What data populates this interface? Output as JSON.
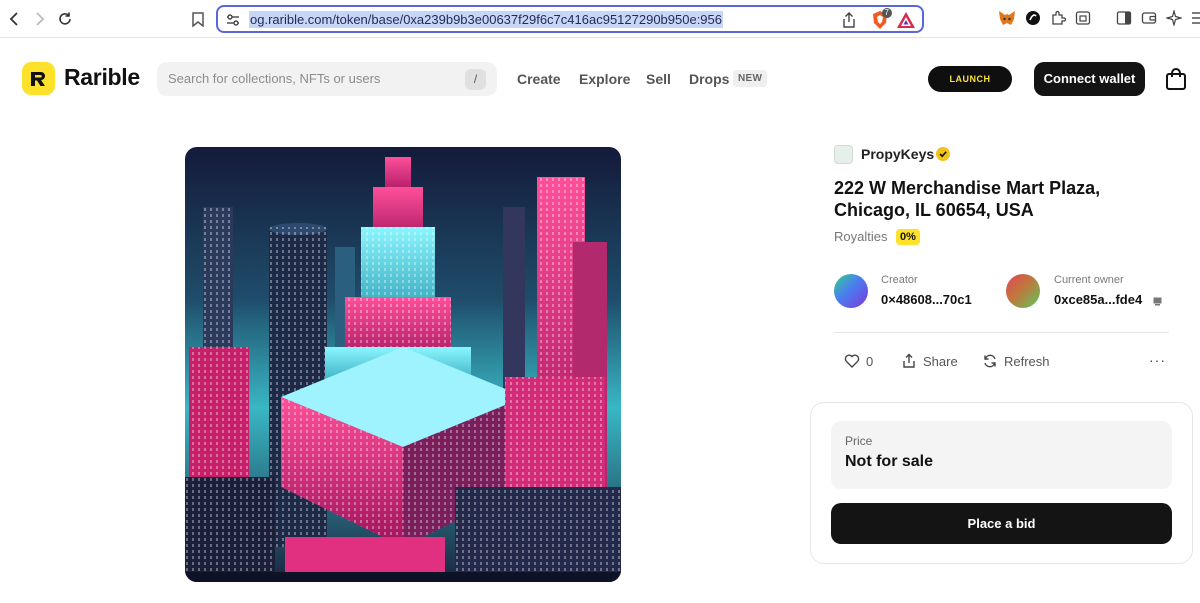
{
  "browser": {
    "url": "og.rarible.com/token/base/0xa239b9b3e00637f29f6c7c416ac95127290b950e:956",
    "shield_count": "7"
  },
  "header": {
    "logo_text": "Rarible",
    "search_placeholder": "Search for collections, NFTs or users",
    "search_shortcut": "/",
    "nav": [
      "Create",
      "Explore",
      "Sell",
      "Drops"
    ],
    "new_badge": "NEW",
    "launch_label": "LAUNCH",
    "connect_label": "Connect wallet"
  },
  "token": {
    "collection": "PropyKeys",
    "title_line1": "222 W Merchandise Mart Plaza,",
    "title_line2": "Chicago, IL 60654, USA",
    "royalties_label": "Royalties",
    "royalties_value": "0%",
    "creator_label": "Creator",
    "creator_value": "0×48608...70c1",
    "owner_label": "Current owner",
    "owner_value": "0xce85a...fde4",
    "likes": "0",
    "share_label": "Share",
    "refresh_label": "Refresh",
    "more_label": "···"
  },
  "price": {
    "label": "Price",
    "value": "Not for sale",
    "bid_label": "Place a bid"
  },
  "colors": {
    "brand_yellow": "#fee12b",
    "dark": "#141414",
    "url_highlight": "#c8d6f5"
  }
}
